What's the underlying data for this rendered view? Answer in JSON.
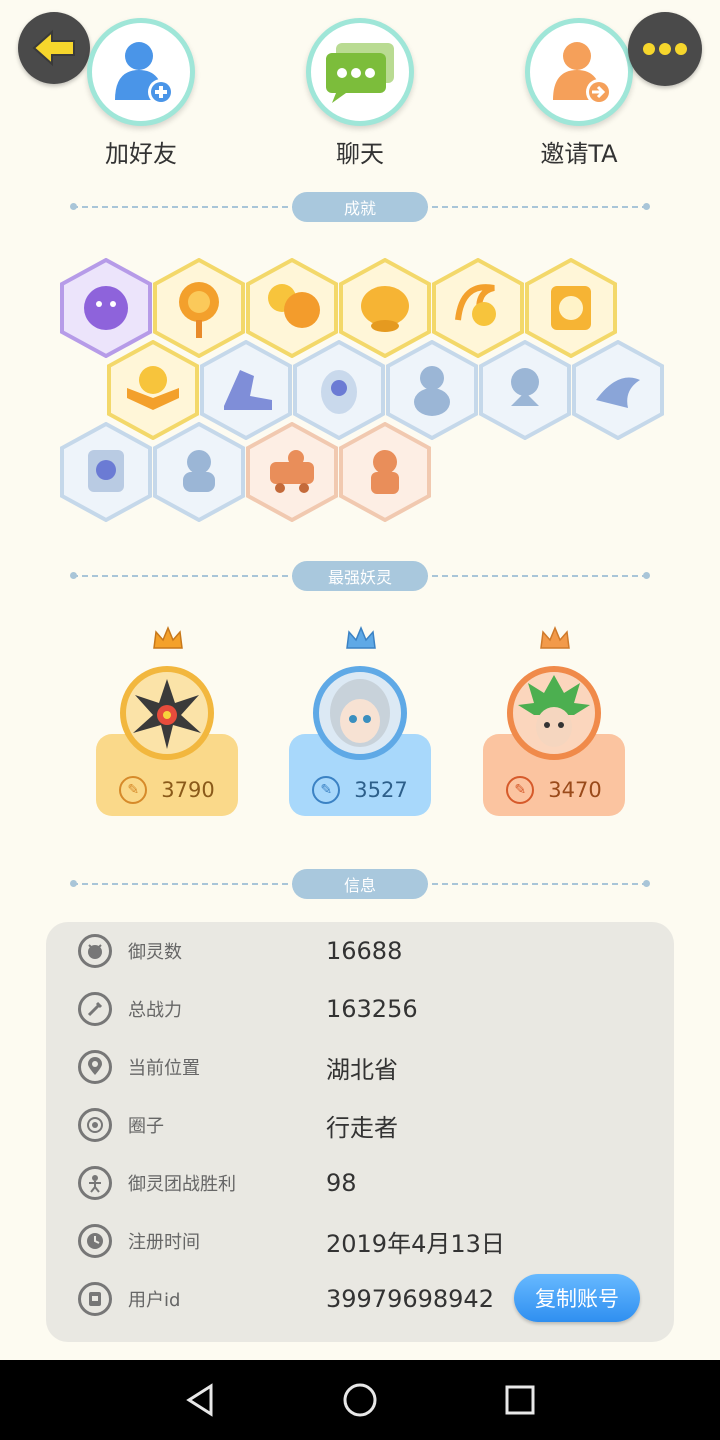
{
  "actions": {
    "add_friend": "加好友",
    "chat": "聊天",
    "invite": "邀请TA"
  },
  "sections": {
    "achievements": "成就",
    "strongest": "最强妖灵",
    "info": "信息"
  },
  "spirits": [
    {
      "power": "3790",
      "theme": "gold"
    },
    {
      "power": "3527",
      "theme": "blue"
    },
    {
      "power": "3470",
      "theme": "orange"
    }
  ],
  "info": {
    "rows": [
      {
        "icon": "spirit-count-icon",
        "key": "御灵数",
        "value": "16688"
      },
      {
        "icon": "combat-power-icon",
        "key": "总战力",
        "value": "163256"
      },
      {
        "icon": "location-pin-icon",
        "key": "当前位置",
        "value": "湖北省"
      },
      {
        "icon": "circle-icon",
        "key": "圈子",
        "value": "行走者"
      },
      {
        "icon": "team-battle-icon",
        "key": "御灵团战胜利",
        "value": "98"
      },
      {
        "icon": "clock-icon",
        "key": "注册时间",
        "value": "2019年4月13日"
      },
      {
        "icon": "user-id-icon",
        "key": "用户id",
        "value": "39979698942"
      }
    ],
    "copy_button": "复制账号"
  },
  "colors": {
    "background": "#fdfbf1",
    "panel": "#e9e8e2",
    "accent_teal": "#9fe6d8",
    "copy_button": "#3d9cf5"
  }
}
